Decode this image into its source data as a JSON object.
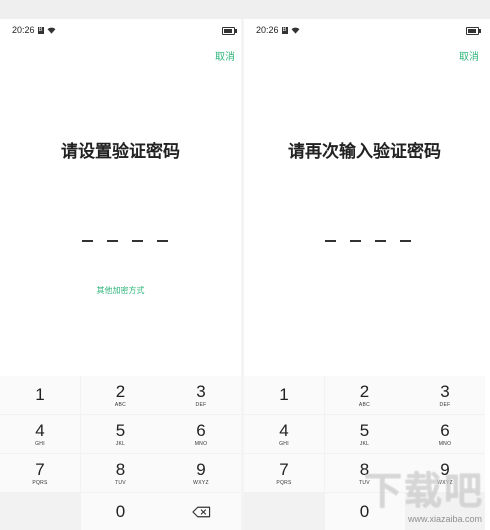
{
  "colors": {
    "accent": "#2fb47a",
    "keypad_bg": "#f2f2f2",
    "key_bg": "#fafafa"
  },
  "status_bar": {
    "time": "20:26",
    "sim_label": "B"
  },
  "screens": [
    {
      "cancel_label": "取消",
      "title": "请设置验证密码",
      "digits_entered": 0,
      "digits_total": 4,
      "other_method_label": "其他加密方式"
    },
    {
      "cancel_label": "取消",
      "title": "请再次输入验证密码",
      "digits_entered": 0,
      "digits_total": 4
    }
  ],
  "keypad": {
    "keys": [
      {
        "digit": "1",
        "letters": ""
      },
      {
        "digit": "2",
        "letters": "ABC"
      },
      {
        "digit": "3",
        "letters": "DEF"
      },
      {
        "digit": "4",
        "letters": "GHI"
      },
      {
        "digit": "5",
        "letters": "JKL"
      },
      {
        "digit": "6",
        "letters": "MNO"
      },
      {
        "digit": "7",
        "letters": "PQRS"
      },
      {
        "digit": "8",
        "letters": "TUV"
      },
      {
        "digit": "9",
        "letters": "WXYZ"
      },
      {
        "digit": "0",
        "letters": ""
      }
    ],
    "delete_icon": "backspace-icon"
  },
  "watermark": {
    "logo_text": "下载吧",
    "url": "www.xiazaiba.com"
  }
}
